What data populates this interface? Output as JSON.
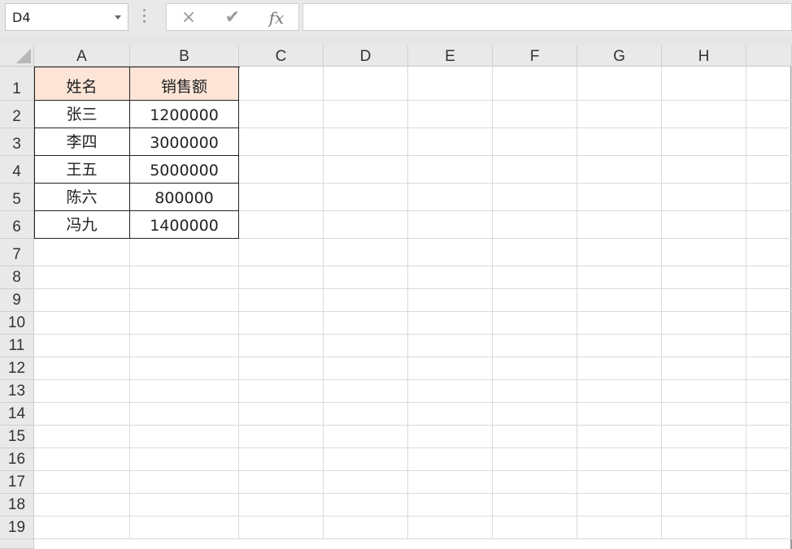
{
  "name_box": "D4",
  "formula_bar": {
    "cancel_icon": "×",
    "enter_icon": "✔",
    "fx_label": "fx",
    "formula": ""
  },
  "columns": [
    "A",
    "B",
    "C",
    "D",
    "E",
    "F",
    "G",
    "H"
  ],
  "rows": [
    "1",
    "2",
    "3",
    "4",
    "5",
    "6",
    "7",
    "8",
    "9",
    "10",
    "11",
    "12",
    "13",
    "14",
    "15",
    "16",
    "17",
    "18",
    "19"
  ],
  "table": {
    "header": [
      "姓名",
      "销售额"
    ],
    "header_fill": "#fce4d6",
    "rows": [
      [
        "张三",
        "1200000"
      ],
      [
        "李四",
        "3000000"
      ],
      [
        "王五",
        "5000000"
      ],
      [
        "陈六",
        "800000"
      ],
      [
        "冯九",
        "1400000"
      ]
    ]
  }
}
